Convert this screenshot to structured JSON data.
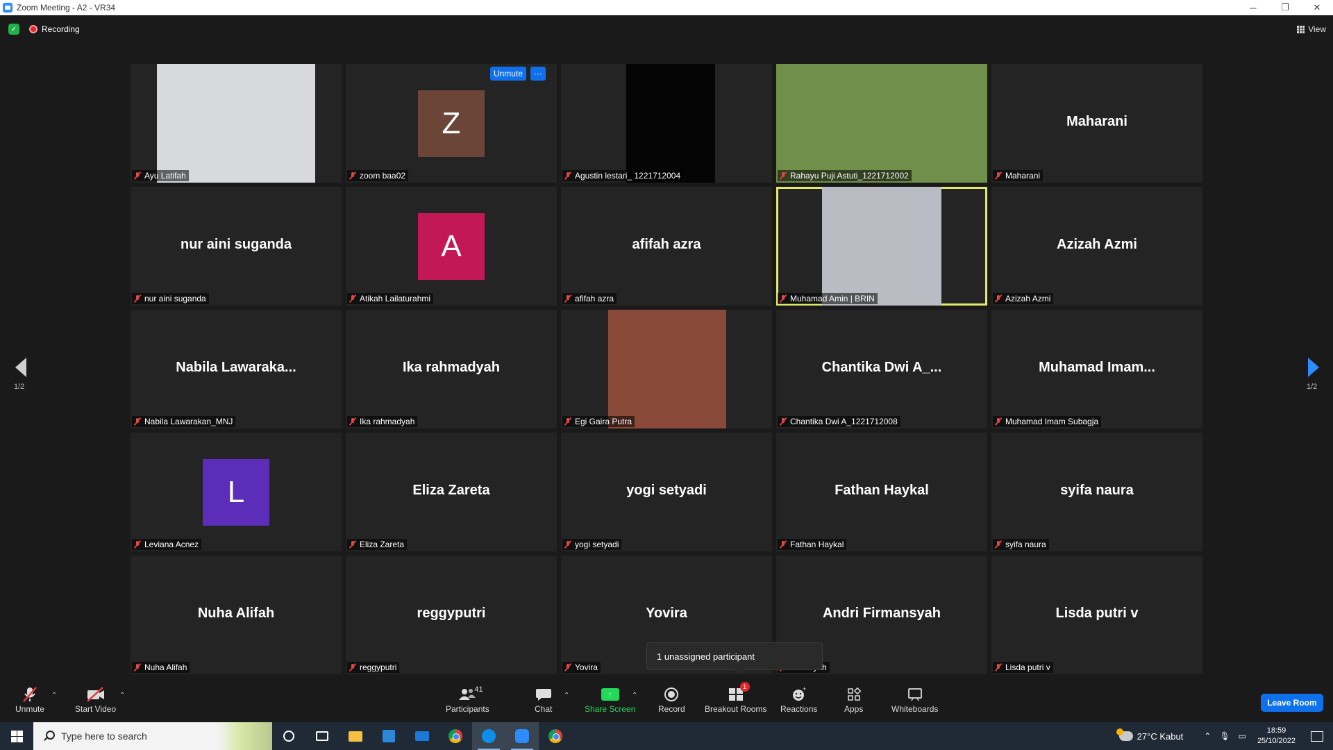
{
  "window": {
    "title": "Zoom Meeting - A2 - VR34",
    "min": "─",
    "restore": "❐",
    "close": "✕"
  },
  "topbar": {
    "recording_label": "Recording",
    "view_label": "View"
  },
  "tiles": [
    {
      "name": "Ayu Latifah",
      "type": "video",
      "video_color": "#d7d9dc"
    },
    {
      "name": "zoom baa02",
      "type": "avatar",
      "letter": "Z",
      "avatar_color": "#6b4538",
      "overlay": {
        "unmute": "Unmute",
        "more": "···"
      }
    },
    {
      "name": "Agustin lestari_ 1221712004",
      "type": "video",
      "video_color": "#050505"
    },
    {
      "name": "Rahayu Puji Astuti_1221712002",
      "type": "video",
      "video_color": "#6f8f4a"
    },
    {
      "name": "Maharani",
      "type": "name",
      "display": "Maharani"
    },
    {
      "name": "nur aini suganda",
      "type": "name",
      "display": "nur aini suganda"
    },
    {
      "name": "Atikah Lailaturahmi",
      "type": "avatar",
      "letter": "A",
      "avatar_color": "#c21856"
    },
    {
      "name": "afifah azra",
      "type": "name",
      "display": "afifah azra"
    },
    {
      "name": "Muhamad Amin | BRIN",
      "type": "video",
      "video_color": "#b9bcc2",
      "speaking": true
    },
    {
      "name": "Azizah Azmi",
      "type": "name",
      "display": "Azizah Azmi"
    },
    {
      "name": "Nabila Lawarakan_MNJ",
      "type": "name",
      "display": "Nabila  Lawaraka..."
    },
    {
      "name": "Ika rahmadyah",
      "type": "name",
      "display": "Ika rahmadyah"
    },
    {
      "name": "Egi Gaira Putra",
      "type": "video",
      "video_color": "#8a4a3a"
    },
    {
      "name": "Chantika Dwi A_1221712008",
      "type": "name",
      "display": "Chantika  Dwi  A_..."
    },
    {
      "name": "Muhamad Imam Subagja",
      "type": "name",
      "display": "Muhamad  Imam..."
    },
    {
      "name": "Leviana Acnez",
      "type": "avatar",
      "letter": "L",
      "avatar_color": "#5b2db8"
    },
    {
      "name": "Eliza Zareta",
      "type": "name",
      "display": "Eliza Zareta"
    },
    {
      "name": "yogi setyadi",
      "type": "name",
      "display": "yogi setyadi"
    },
    {
      "name": "Fathan Haykal",
      "type": "name",
      "display": "Fathan Haykal"
    },
    {
      "name": "syifa naura",
      "type": "name",
      "display": "syifa naura"
    },
    {
      "name": "Nuha Alifah",
      "type": "name",
      "display": "Nuha Alifah"
    },
    {
      "name": "reggyputri",
      "type": "name",
      "display": "reggyputri"
    },
    {
      "name": "Yovira",
      "type": "name",
      "display": "Yovira"
    },
    {
      "name": "rmansyah",
      "type": "name",
      "display": "Andri Firmansyah"
    },
    {
      "name": "Lisda putri v",
      "type": "name",
      "display": "Lisda putri v"
    }
  ],
  "paging": {
    "left_label": "1/2",
    "right_label": "1/2"
  },
  "tooltip": "1 unassigned participant",
  "toolbar": {
    "unmute": "Unmute",
    "start_video": "Start Video",
    "participants": "Participants",
    "participants_count": "41",
    "chat": "Chat",
    "share_screen": "Share Screen",
    "record": "Record",
    "breakout_rooms": "Breakout Rooms",
    "breakout_badge": "1",
    "reactions": "Reactions",
    "apps": "Apps",
    "whiteboards": "Whiteboards",
    "leave": "Leave Room"
  },
  "taskbar": {
    "search_placeholder": "Type here to search",
    "weather": "27°C  Kabut",
    "time": "18:59",
    "date": "25/10/2022"
  }
}
